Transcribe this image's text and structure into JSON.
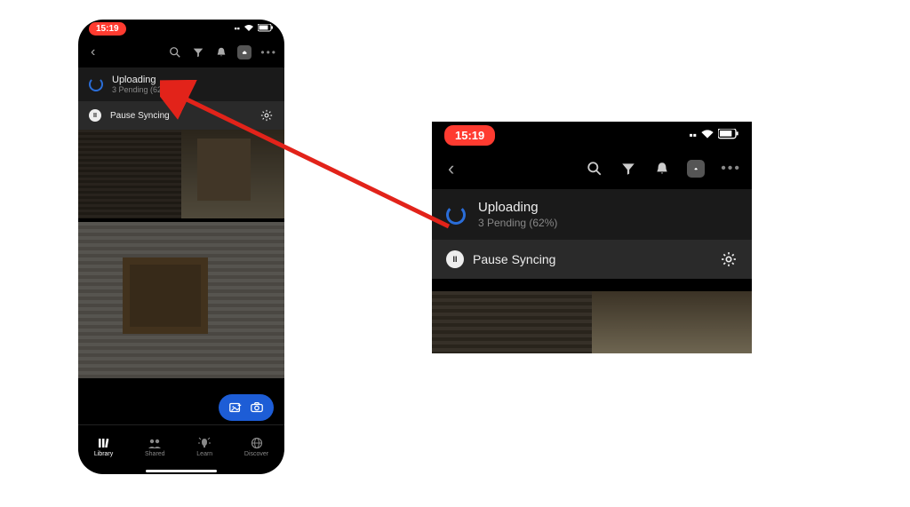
{
  "statusbar": {
    "time": "15:19"
  },
  "upload": {
    "title": "Uploading",
    "pending_count": 3,
    "pending_label": "Pending",
    "percent": 62,
    "subtitle": "3 Pending  (62%)"
  },
  "pause": {
    "label": "Pause Syncing"
  },
  "bottomnav": {
    "library": "Library",
    "shared": "Shared",
    "learn": "Learn",
    "discover": "Discover"
  },
  "colors": {
    "time_pill": "#ff3b30",
    "spinner": "#2a6dd8",
    "float_button": "#1d5dd6"
  }
}
